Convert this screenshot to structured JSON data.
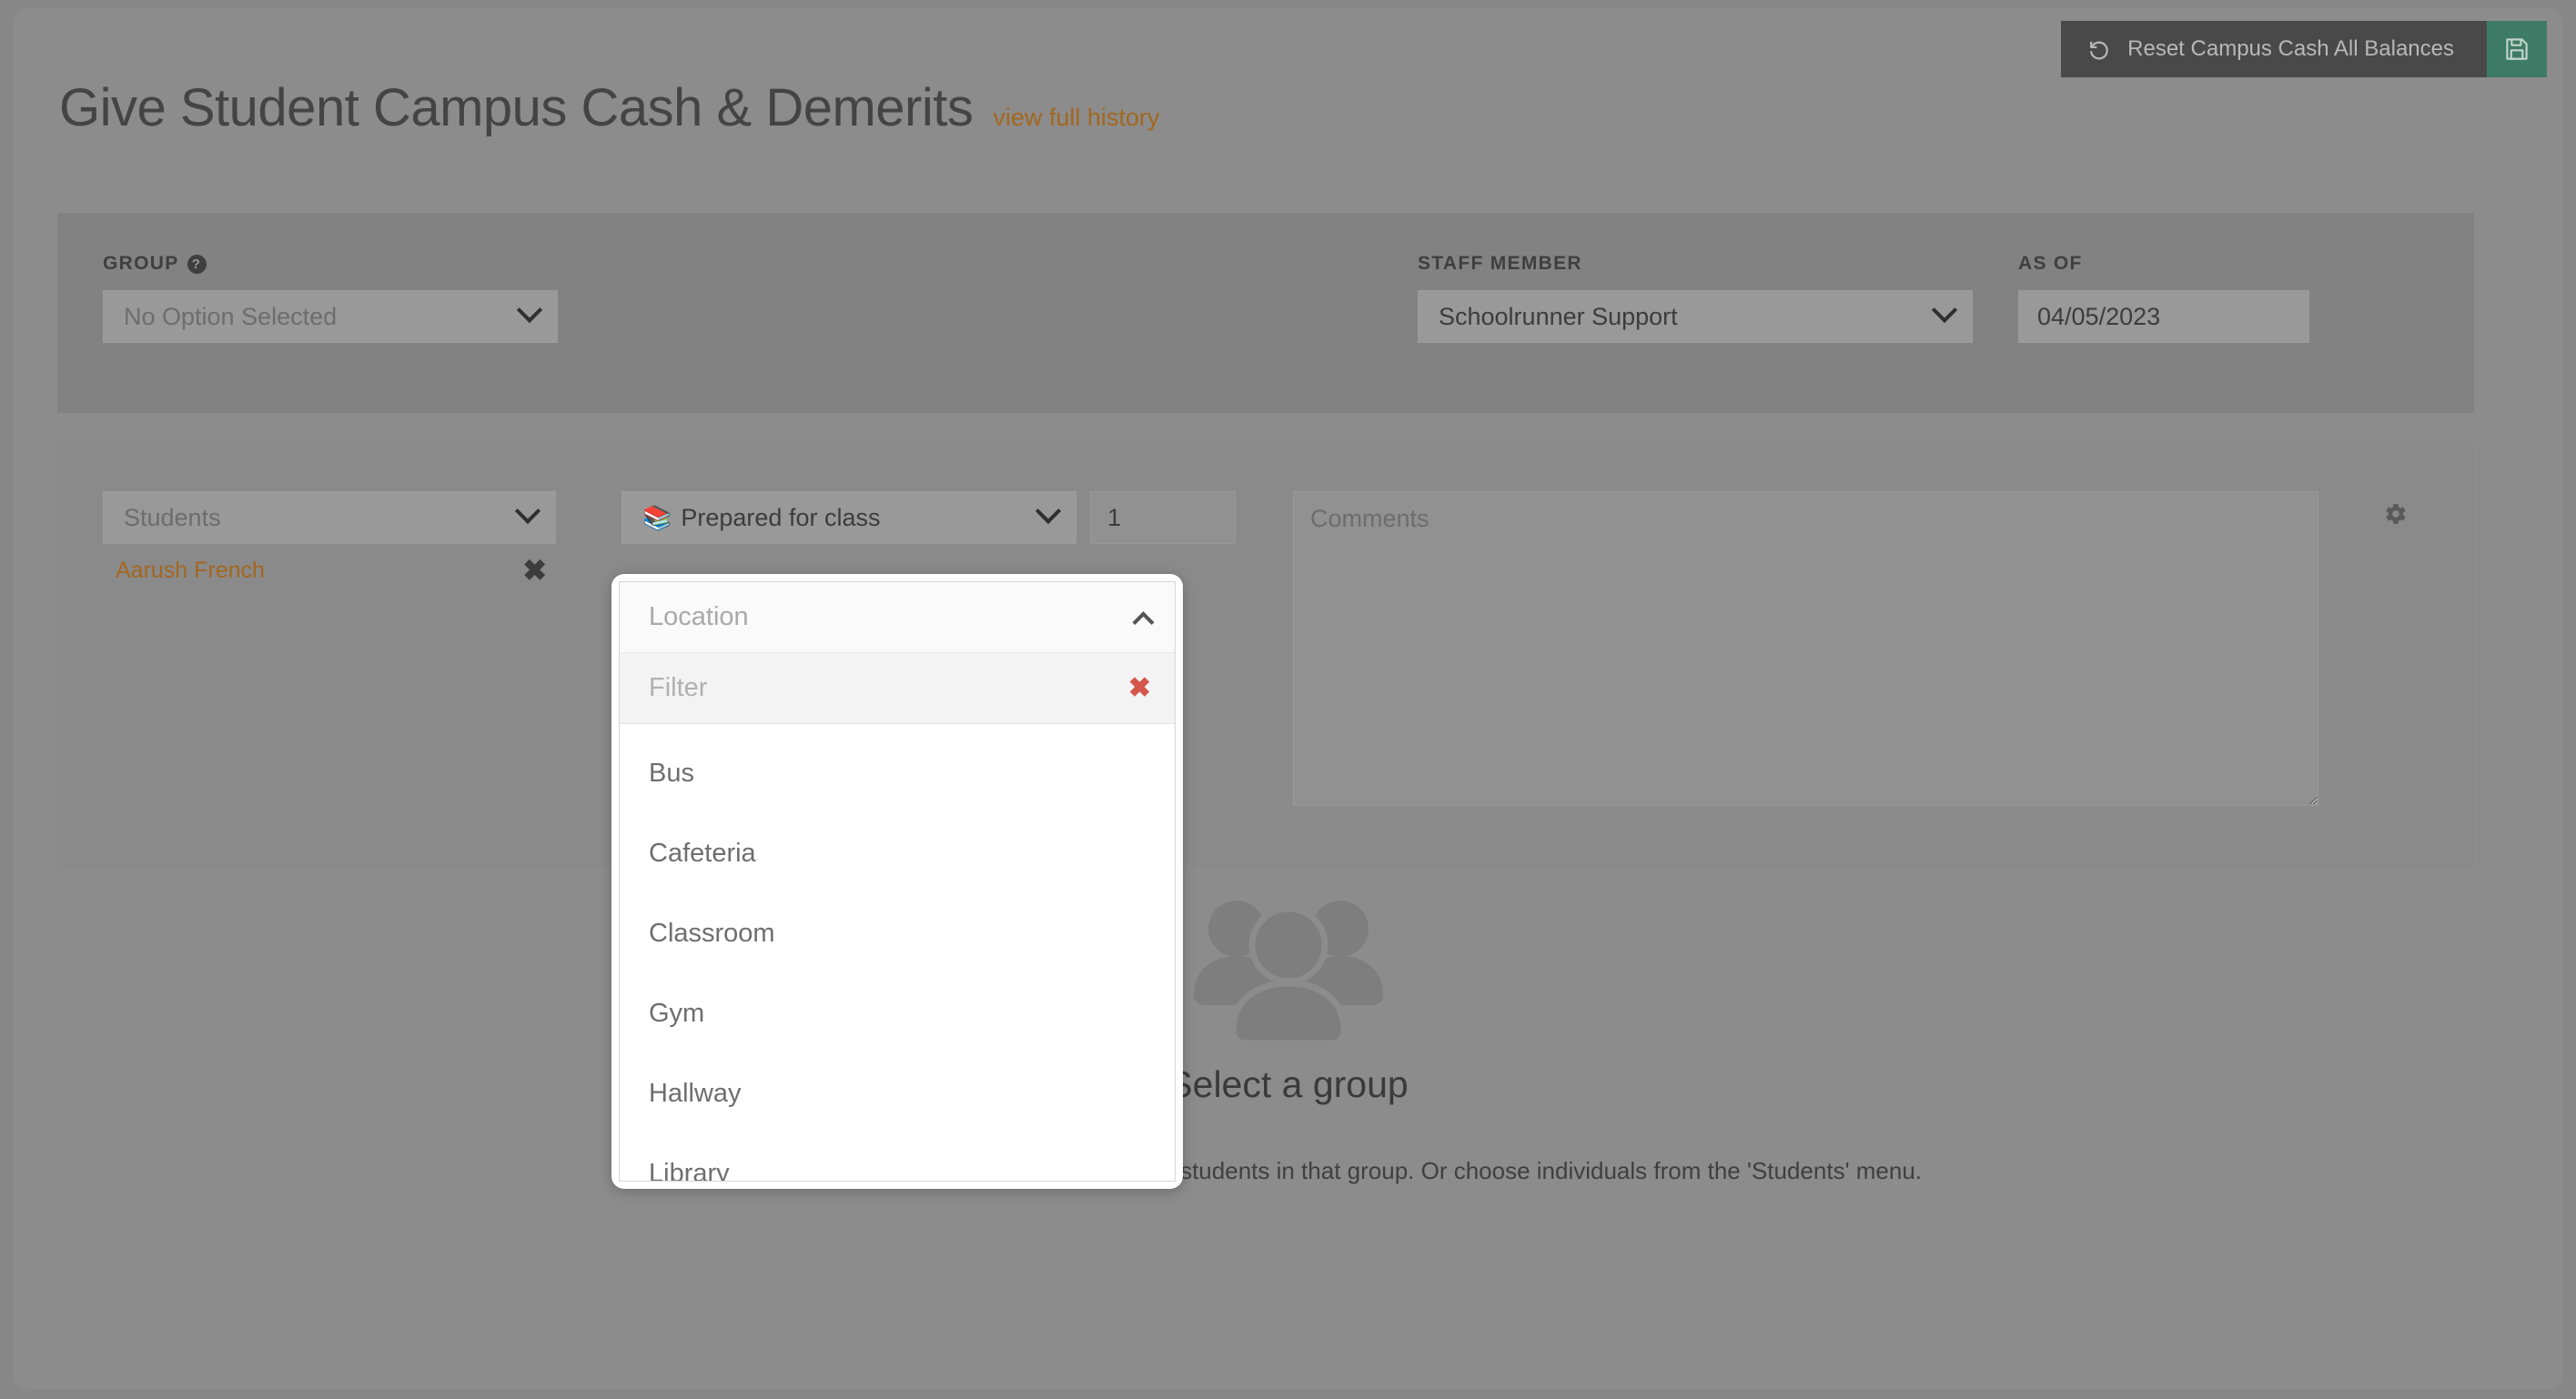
{
  "header": {
    "title": "Give Student Campus Cash & Demerits",
    "history_link": "view full history",
    "reset_button": "Reset Campus Cash All Balances",
    "reset_icon": "undo-icon",
    "save_icon": "floppy-disk-icon"
  },
  "filters": {
    "group": {
      "label": "GROUP",
      "help_icon": "?",
      "value": "No Option Selected"
    },
    "staff": {
      "label": "STAFF MEMBER",
      "value": "Schoolrunner Support"
    },
    "as_of": {
      "label": "AS OF",
      "value": "04/05/2023"
    }
  },
  "entry_row": {
    "student_select": {
      "placeholder": "Students"
    },
    "selected_students": [
      {
        "name": "Aarush French",
        "remove_label": "✖"
      }
    ],
    "behavior_select": {
      "emoji": "📚",
      "value": "Prepared for class"
    },
    "quantity": {
      "value": "1"
    },
    "comments": {
      "placeholder": "Comments"
    },
    "settings_icon": "gear-icon"
  },
  "location_menu": {
    "title": "Location",
    "collapse_icon": "chevron-up-icon",
    "filter_placeholder": "Filter",
    "filter_value": "",
    "clear_label": "✖",
    "options": [
      "Bus",
      "Cafeteria",
      "Classroom",
      "Gym",
      "Hallway",
      "Library"
    ]
  },
  "empty_state": {
    "icon": "users-group-icon",
    "title": "Select a group",
    "description": "Select a group above to log behaviors for multiple students in that group. Or choose individuals from the 'Students' menu."
  },
  "colors": {
    "page_background": "#8c8c8c",
    "panel_dark": "#828282",
    "panel_light": "#8a8a8a",
    "accent_orange": "#a3671f",
    "save_green": "#3e7b66",
    "reset_dark": "#494949",
    "clear_red": "#d4564a"
  }
}
